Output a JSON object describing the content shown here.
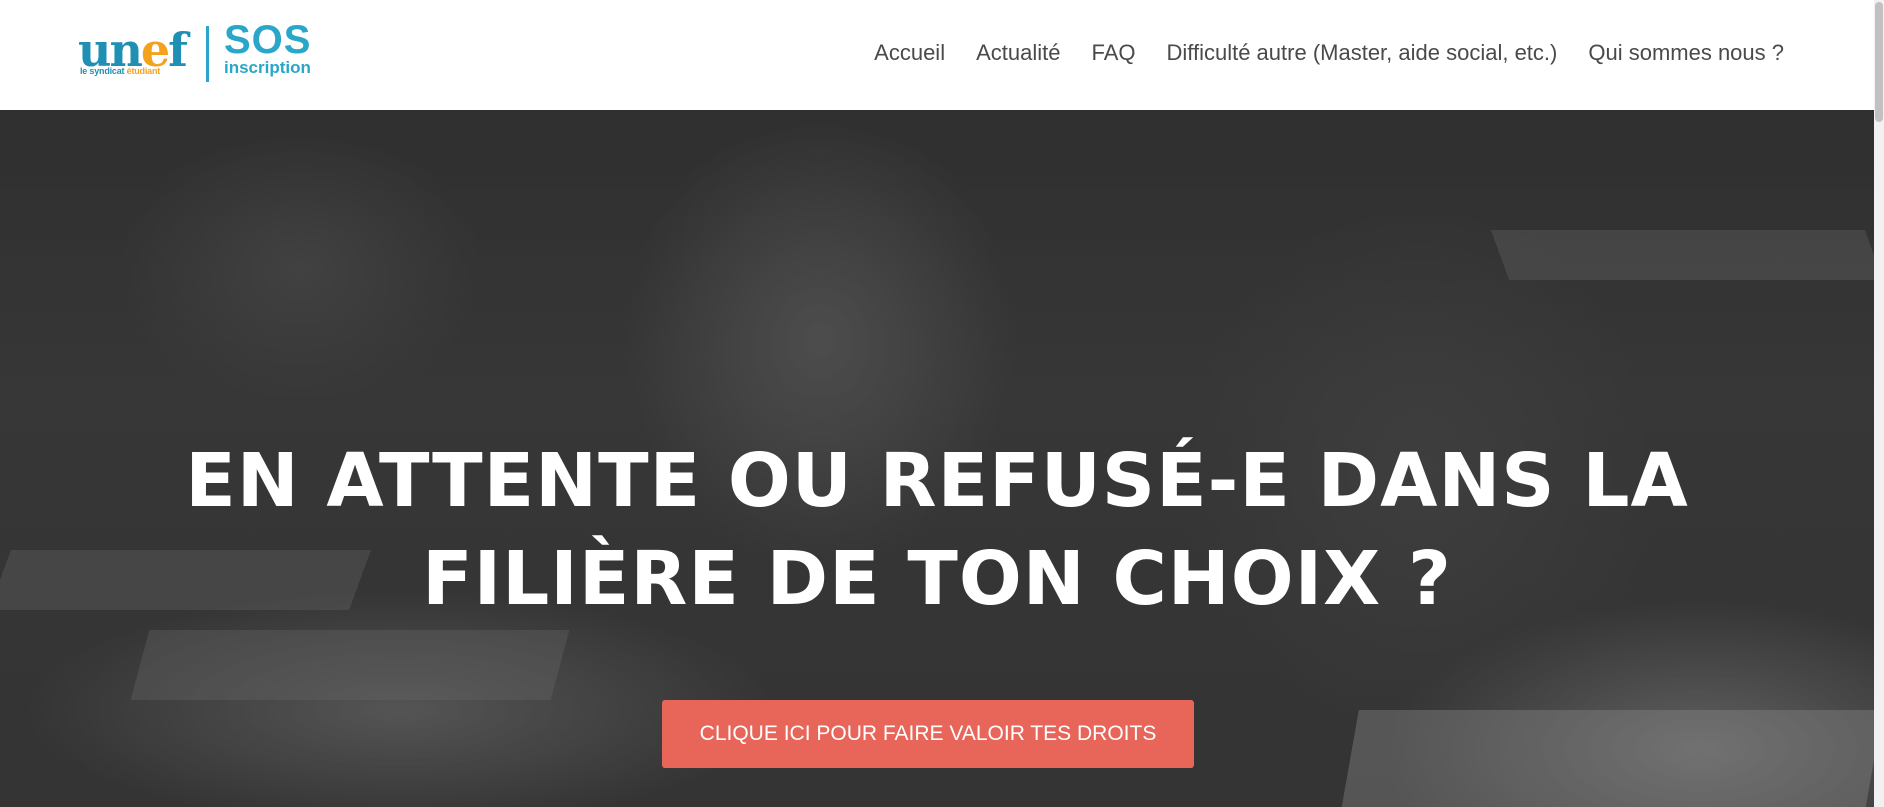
{
  "logo": {
    "brand": "unef",
    "tagline_part1": "le syndicat",
    "tagline_part2": "étudiant",
    "sos": "SOS",
    "inscription": "inscription"
  },
  "nav": {
    "items": [
      {
        "label": "Accueil"
      },
      {
        "label": "Actualité"
      },
      {
        "label": "FAQ"
      },
      {
        "label": "Difficulté autre (Master, aide social, etc.)"
      },
      {
        "label": "Qui sommes nous ?"
      }
    ]
  },
  "hero": {
    "title_line1": "EN ATTENTE OU REFUSÉ-E DANS LA",
    "title_line2": "FILIÈRE DE TON CHOIX ?",
    "cta_label": "CLIQUE ICI POUR FAIRE VALOIR TES DROITS"
  },
  "colors": {
    "brand_blue": "#2aa6c8",
    "brand_orange": "#f4a21e",
    "cta": "#e8655a",
    "nav_text": "#4a4a4a"
  }
}
